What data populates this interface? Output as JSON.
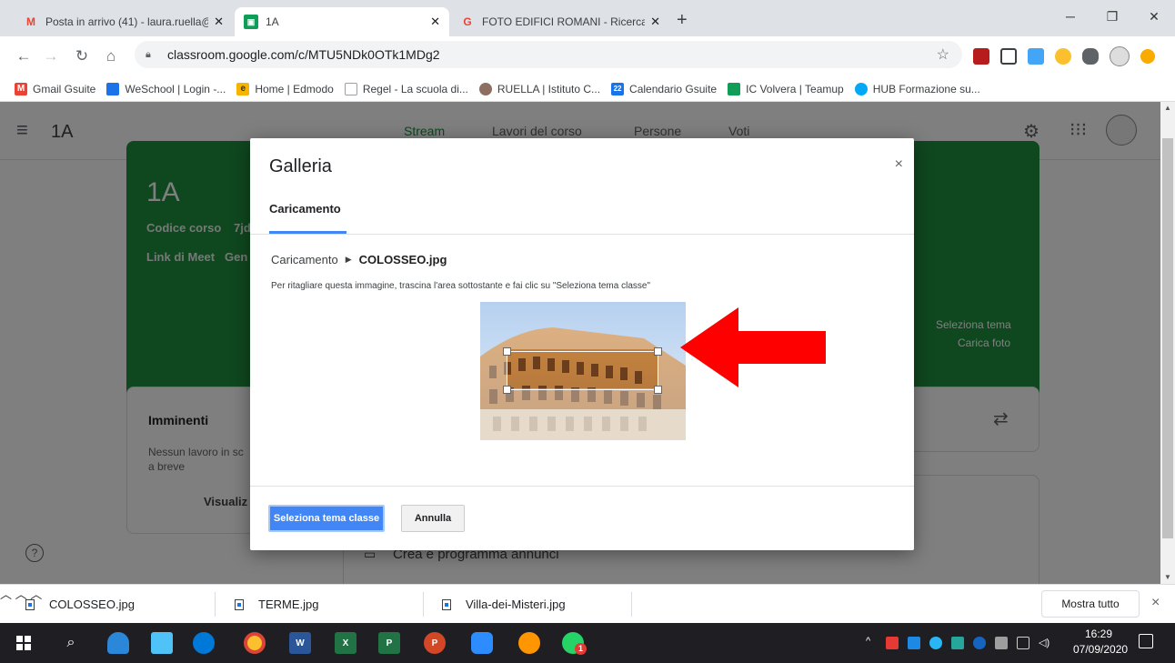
{
  "browser": {
    "tabs": [
      {
        "title": "Posta in arrivo (41) - laura.ruella@",
        "icon": "gmail-icon"
      },
      {
        "title": "1A",
        "icon": "classroom-icon",
        "active": true
      },
      {
        "title": "FOTO EDIFICI ROMANI - Ricerca ",
        "icon": "google-icon"
      }
    ],
    "new_tab": "+",
    "url": "classroom.google.com/c/MTU5NDk0OTk1MDg2",
    "bookmarks": [
      {
        "label": "Gmail Gsuite",
        "icon": "gmail-icon",
        "color": "#ea4335"
      },
      {
        "label": "WeSchool | Login -...",
        "icon": "weschool-icon",
        "color": "#1a73e8"
      },
      {
        "label": "Home | Edmodo",
        "icon": "edmodo-icon",
        "color": "#f4b400"
      },
      {
        "label": "Regel - La scuola di...",
        "icon": "page-icon",
        "color": "#9aa0a6"
      },
      {
        "label": "RUELLA | Istituto C...",
        "icon": "school-icon",
        "color": "#8d6e63"
      },
      {
        "label": "Calendario Gsuite",
        "icon": "calendar-icon",
        "color": "#1a73e8"
      },
      {
        "label": "IC Volvera | Teamup",
        "icon": "teamup-icon",
        "color": "#0f9d58"
      },
      {
        "label": "HUB Formazione su...",
        "icon": "hub-icon",
        "color": "#03a9f4"
      }
    ]
  },
  "classroom": {
    "course_name": "1A",
    "nav_tabs": [
      "Stream",
      "Lavori del corso",
      "Persone",
      "Voti"
    ],
    "banner": {
      "title": "1A",
      "course_code_label": "Codice corso",
      "course_code_value": "7jd",
      "meet_label": "Link di Meet",
      "meet_value": "Gen",
      "select_theme": "Seleziona tema",
      "upload_photo": "Carica foto"
    },
    "upcoming": {
      "title": "Imminenti",
      "text_line1": "Nessun lavoro in sc",
      "text_line2": "a breve",
      "view_all": "Visualiz"
    },
    "announce": "Crea e programma annunci"
  },
  "dialog": {
    "title": "Galleria",
    "close": "×",
    "tab": "Caricamento",
    "breadcrumb_root": "Caricamento",
    "breadcrumb_file": "COLOSSEO.jpg",
    "instruction": "Per ritagliare questa immagine, trascina l'area sottostante e fai clic su \"Seleziona tema classe\"",
    "primary_button": "Seleziona tema classe",
    "cancel_button": "Annulla"
  },
  "downloads": {
    "items": [
      "COLOSSEO.jpg",
      "TERME.jpg",
      "Villa-dei-Misteri.jpg"
    ],
    "show_all": "Mostra tutto",
    "close": "×"
  },
  "taskbar": {
    "time": "16:29",
    "date": "07/09/2020",
    "whatsapp_badge": "1"
  }
}
